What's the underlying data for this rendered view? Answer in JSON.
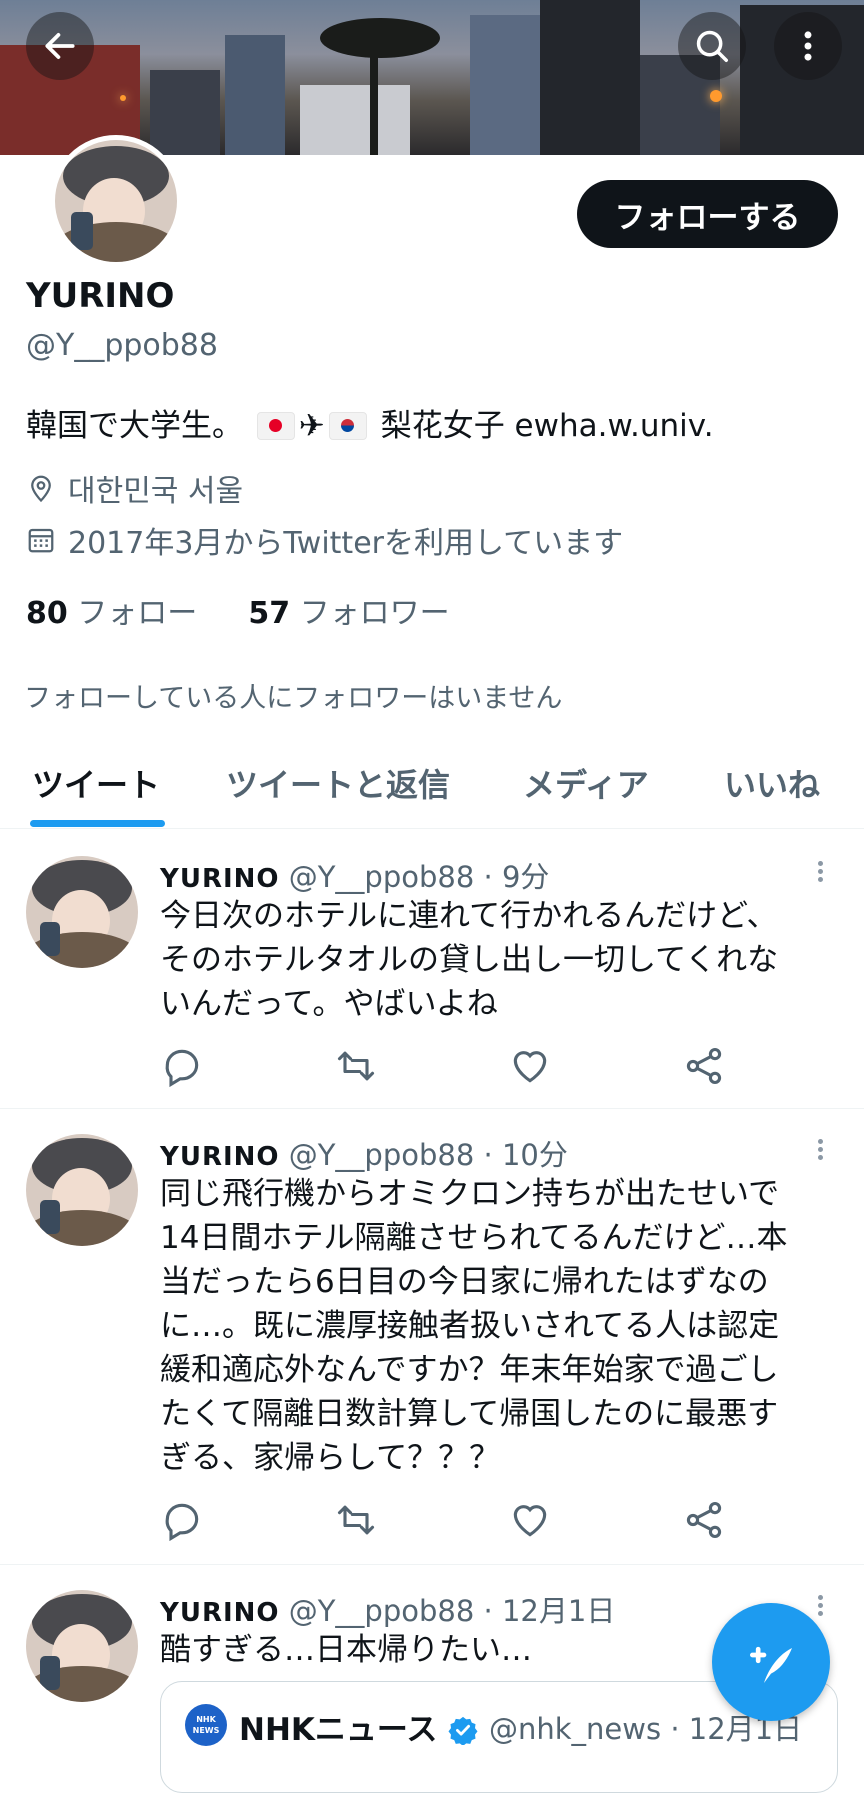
{
  "profile": {
    "follow_label": "フォローする",
    "name": "YURINO",
    "handle": "@Y__ppob88",
    "bio_prefix": "韓国で大学生。",
    "bio_suffix": "梨花女子 ewha.w.univ.",
    "location": "대한민국 서울",
    "joined": "2017年3月からTwitterを利用しています",
    "following_count": "80",
    "following_label": "フォロー",
    "followers_count": "57",
    "followers_label": "フォロワー",
    "no_mutuals": "フォローしている人にフォロワーはいません"
  },
  "tabs": [
    "ツイート",
    "ツイートと返信",
    "メディア",
    "いいね"
  ],
  "tweets": [
    {
      "name": "YURINO",
      "handle": "@Y__ppob88",
      "time": "9分",
      "text": "今日次のホテルに連れて行かれるんだけど、\nそのホテルタオルの貸し出し一切してくれな\nいんだって。やばいよね"
    },
    {
      "name": "YURINO",
      "handle": "@Y__ppob88",
      "time": "10分",
      "text": "同じ飛行機からオミクロン持ちが出たせいで\n14日間ホテル隔離させられてるんだけど…本\n当だったら6日目の今日家に帰れたはずなの\nに…。既に濃厚接触者扱いされてる人は認定\n緩和適応外なんですか？年末年始家で過ごし\nたくて隔離日数計算して帰国したのに最悪す\nぎる、家帰らして？？？"
    },
    {
      "name": "YURINO",
      "handle": "@Y__ppob88",
      "time": "12月1日",
      "text": "酷すぎる…日本帰りたい…",
      "quote": {
        "logo_text": "NHK NEWS",
        "name": "NHKニュース",
        "handle": "@nhk_news",
        "time": "12月1日"
      }
    }
  ],
  "colors": {
    "accent": "#1d9bf0",
    "text": "#0f1419",
    "secondary": "#536471"
  },
  "icons": [
    "back-arrow-icon",
    "search-icon",
    "more-vertical-icon",
    "location-pin-icon",
    "calendar-icon",
    "reply-icon",
    "retweet-icon",
    "like-icon",
    "share-icon",
    "compose-icon",
    "verified-icon"
  ]
}
